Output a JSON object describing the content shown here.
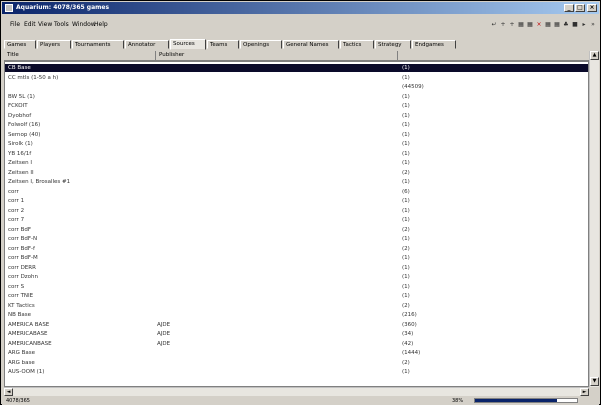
{
  "window": {
    "title": "Aquarium: 4078/365 games",
    "buttons": [
      "_",
      "□",
      "×"
    ]
  },
  "menu": [
    "File",
    "Edit",
    "View",
    "Tools",
    "Window",
    "Help"
  ],
  "toolbar": {
    "icons": [
      "arrow-icon",
      "plus-icon",
      "plus-icon",
      "board-icon",
      "board-icon",
      "close-icon",
      "board-icon",
      "board-icon",
      "tree-icon",
      "book-icon",
      "play-icon",
      "more-icon"
    ]
  },
  "tabs": [
    "Games",
    "Players",
    "Tournaments",
    "Annotator",
    "Sources",
    "Teams",
    "Openings",
    "General Names",
    "Tactics",
    "Strategy",
    "Endgames"
  ],
  "active_tab": "Sources",
  "columns": [
    "Title",
    "Publisher",
    ""
  ],
  "rows": [
    {
      "title": "CB Base",
      "publisher": "",
      "count": "(1)"
    },
    {
      "title": "CC mtls (1-50 a h)",
      "publisher": "",
      "count": "(1)"
    },
    {
      "title": "",
      "publisher": "",
      "count": "(44509)"
    },
    {
      "title": "BW 5L (1)",
      "publisher": "",
      "count": "(1)"
    },
    {
      "title": "FCKOIT",
      "publisher": "",
      "count": "(1)"
    },
    {
      "title": "Dyobhof",
      "publisher": "",
      "count": "(1)"
    },
    {
      "title": "Folwolf (16)",
      "publisher": "",
      "count": "(1)"
    },
    {
      "title": "Sernop (40)",
      "publisher": "",
      "count": "(1)"
    },
    {
      "title": "Sirolk (1)",
      "publisher": "",
      "count": "(1)"
    },
    {
      "title": "YB 16/1f",
      "publisher": "",
      "count": "(1)"
    },
    {
      "title": "Zeitsen I",
      "publisher": "",
      "count": "(1)"
    },
    {
      "title": "Zeitsen II",
      "publisher": "",
      "count": "(2)"
    },
    {
      "title": "Zeitsen I, Brosalles #1",
      "publisher": "",
      "count": "(1)"
    },
    {
      "title": "corr",
      "publisher": "",
      "count": "(6)"
    },
    {
      "title": "corr 1",
      "publisher": "",
      "count": "(1)"
    },
    {
      "title": "corr 2",
      "publisher": "",
      "count": "(1)"
    },
    {
      "title": "corr 7",
      "publisher": "",
      "count": "(1)"
    },
    {
      "title": "corr BdF",
      "publisher": "",
      "count": "(2)"
    },
    {
      "title": "corr BdF-N",
      "publisher": "",
      "count": "(1)"
    },
    {
      "title": "corr BdF-f",
      "publisher": "",
      "count": "(2)"
    },
    {
      "title": "corr BdF-M",
      "publisher": "",
      "count": "(1)"
    },
    {
      "title": "corr DERR",
      "publisher": "",
      "count": "(1)"
    },
    {
      "title": "corr Dzohn",
      "publisher": "",
      "count": "(1)"
    },
    {
      "title": "corr S",
      "publisher": "",
      "count": "(1)"
    },
    {
      "title": "corr TNIE",
      "publisher": "",
      "count": "(1)"
    },
    {
      "title": "KT Tactics",
      "publisher": "",
      "count": "(2)"
    },
    {
      "title": "NB Base",
      "publisher": "",
      "count": "(216)"
    },
    {
      "title": "AMERICA BASE",
      "publisher": "AJDE",
      "count": "(360)"
    },
    {
      "title": "AMERICABASE",
      "publisher": "AJDE",
      "count": "(34)"
    },
    {
      "title": "AMERICANBASE",
      "publisher": "AJDE",
      "count": "(42)"
    },
    {
      "title": "ARG Base",
      "publisher": "",
      "count": "(1444)"
    },
    {
      "title": "ARG base",
      "publisher": "",
      "count": "(2)"
    },
    {
      "title": "AUS-OOM (1)",
      "publisher": "",
      "count": "(1)"
    }
  ],
  "selected_row_index": 0,
  "status": {
    "left": "4078/365",
    "percent_text": "38%"
  },
  "progress_fraction": 0.8
}
